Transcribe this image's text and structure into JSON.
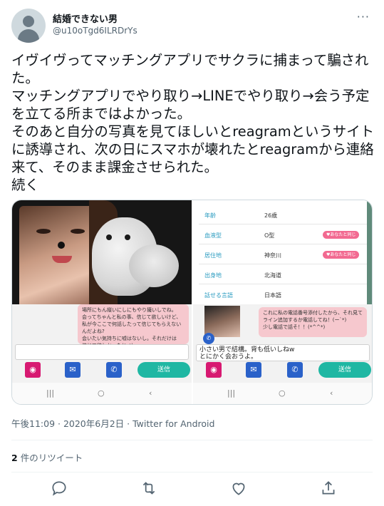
{
  "author": {
    "name": "結婚できない男",
    "handle": "@u10oTgd6ILRDrYs"
  },
  "more_label": "···",
  "tweet_text": "イヴイヴってマッチングアプリでサクラに捕まって騙された。\nマッチングアプリでやり取り→LINEでやり取り→会う予定を立てる所まではよかった。\nそのあと自分の写真を見てほしいとreagramというサイトに誘導され、次の日にスマホが壊れたとreagramから連絡来て、そのまま課金させられた。\n続く",
  "media": {
    "left": {
      "bubble_text": "場所にもん縦いにしにもやり撮いしでね。\n会ってちゃんと私の事、信じて欲しいけど、\n私が今ここで何話したって信じてもらえない\nんだよね?\n会いたい気持ちに嘘はないし。それだけは\n信じて欲しかった(*_*)",
      "input_text": "",
      "send_label": "送信"
    },
    "right": {
      "profile": [
        {
          "key": "年齢",
          "value": "26歳",
          "tag": ""
        },
        {
          "key": "血液型",
          "value": "O型",
          "tag": "♥あなたと同じ"
        },
        {
          "key": "居住地",
          "value": "神奈川",
          "tag": "♥あなたと同じ"
        },
        {
          "key": "出身地",
          "value": "北海道",
          "tag": ""
        },
        {
          "key": "話せる言語",
          "value": "日本語",
          "tag": ""
        }
      ],
      "bubble_text": "これに私の電話番号添付したから、それ見て\nライン追加するか電話してね！(ー`*)\n少し電話で話そ！！(*^^*)",
      "input_text": "小さい男で結構。背も低いしねw\nとにかく会おうよ。",
      "send_label": "送信"
    },
    "nav": [
      "|||",
      "○",
      "‹"
    ]
  },
  "meta": "午後11:09 · 2020年6月2日 · Twitter for Android",
  "retweets": {
    "count": "2",
    "label": "件のリツイート"
  },
  "icons": [
    "reply-icon",
    "retweet-icon",
    "like-icon",
    "share-icon"
  ]
}
